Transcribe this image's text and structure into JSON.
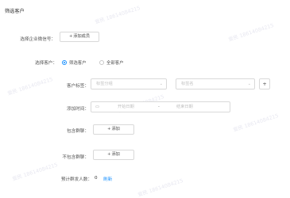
{
  "page": {
    "title": "筛选客户"
  },
  "form": {
    "wechat_account": {
      "label": "选择企业微信号：",
      "add_button": "添加成员"
    },
    "customer_scope": {
      "label": "选择客户：",
      "options": [
        {
          "label": "筛选客户",
          "selected": true
        },
        {
          "label": "全部客户",
          "selected": false
        }
      ]
    },
    "customer_tags": {
      "label": "客户标签：",
      "select1_placeholder": "标签分组",
      "select2_placeholder": "标签名",
      "add_icon_text": "+"
    },
    "add_time": {
      "label": "添加时间：",
      "start_placeholder": "开始日期",
      "separator": "-",
      "end_placeholder": "结束日期"
    },
    "include_group": {
      "label": "包含群聊：",
      "add_button": "添加"
    },
    "exclude_group": {
      "label": "不包含群聊：",
      "add_button": "添加"
    },
    "estimate": {
      "label": "预计群发人数：",
      "count": "0",
      "refresh_link": "刷新"
    }
  },
  "icons": {
    "plus": "+",
    "chevron_down": "⌄",
    "calendar": "▭"
  },
  "colors": {
    "primary": "#1890ff",
    "border": "#d9d9d9",
    "placeholder": "#c0c0c0"
  }
}
